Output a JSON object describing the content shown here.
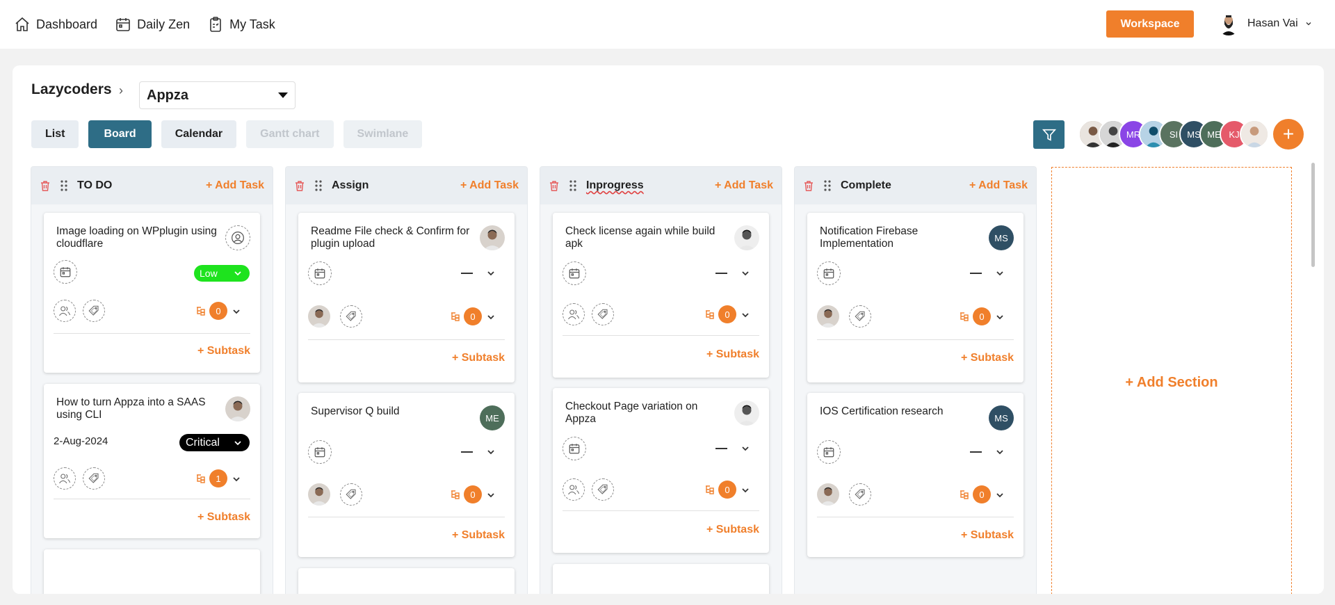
{
  "nav": {
    "items": [
      {
        "label": "Dashboard",
        "icon": "home-icon"
      },
      {
        "label": "Daily Zen",
        "icon": "calendar-icon"
      },
      {
        "label": "My Task",
        "icon": "clipboard-icon"
      }
    ],
    "workspace_label": "Workspace",
    "user_name": "Hasan Vai"
  },
  "breadcrumb": {
    "org": "Lazycoders",
    "project": "Appza"
  },
  "view_tabs": [
    "List",
    "Board",
    "Calendar",
    "Gantt chart",
    "Swimlane"
  ],
  "active_view": "Board",
  "members": [
    {
      "initials": "",
      "color": "#b8a89a"
    },
    {
      "initials": "",
      "color": "#8d8d8d"
    },
    {
      "initials": "MR",
      "color": "#8a45e6"
    },
    {
      "initials": "",
      "color": "#6e9ab8"
    },
    {
      "initials": "SI",
      "color": "#5a7360"
    },
    {
      "initials": "MS",
      "color": "#2f4f64"
    },
    {
      "initials": "ME",
      "color": "#4e6e5a"
    },
    {
      "initials": "KJ",
      "color": "#e55a6a"
    },
    {
      "initials": "",
      "color": "#d9cfc7"
    }
  ],
  "add_task_label": "+ Add Task",
  "add_subtask_label": "+ Subtask",
  "add_section_label": "+ Add Section",
  "columns": [
    {
      "title": "TO DO",
      "cards": [
        {
          "title": "Image loading on WPplugin using cloudflare",
          "priority": "Low",
          "subtasks": "0",
          "date": ""
        },
        {
          "title": "How to turn Appza into a SAAS using CLI",
          "priority": "Critical",
          "subtasks": "1",
          "date": "2-Aug-2024"
        }
      ]
    },
    {
      "title": "Assign",
      "cards": [
        {
          "title": "Readme File check & Confirm for plugin upload",
          "subtasks": "0"
        },
        {
          "title": "Supervisor Q build",
          "subtasks": "0",
          "assignee_initials": "ME"
        }
      ]
    },
    {
      "title": "Inprogress",
      "cards": [
        {
          "title": "Check license again while build apk",
          "subtasks": "0"
        },
        {
          "title": "Checkout Page variation on Appza",
          "subtasks": "0"
        }
      ]
    },
    {
      "title": "Complete",
      "cards": [
        {
          "title": "Notification Firebase Implementation",
          "subtasks": "0",
          "assignee_initials": "MS"
        },
        {
          "title": "IOS Certification research",
          "subtasks": "0",
          "assignee_initials": "MS"
        }
      ]
    }
  ],
  "colors": {
    "accent": "#f07f2b",
    "primary": "#2e6d86",
    "low": "#1ee31e",
    "critical": "#000000"
  }
}
